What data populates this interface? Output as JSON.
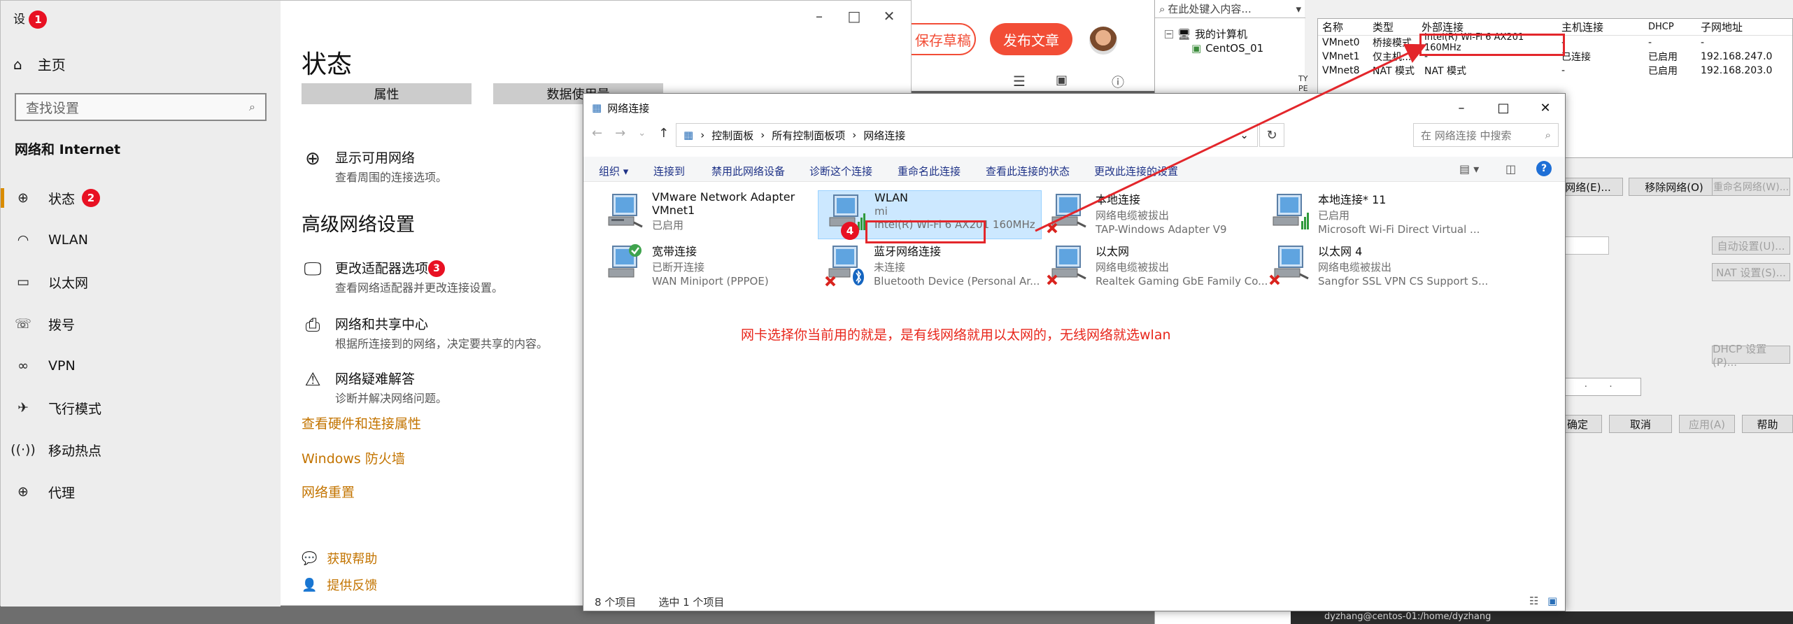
{
  "settings": {
    "title_char": "设",
    "badge1": "1",
    "badge2": "2",
    "badge3": "3",
    "home": "主页",
    "search_placeholder": "查找设置",
    "section": "网络和 Internet",
    "nav": [
      {
        "label": "状态",
        "icon": "globe-icon"
      },
      {
        "label": "WLAN",
        "icon": "wifi-icon"
      },
      {
        "label": "以太网",
        "icon": "ethernet-icon"
      },
      {
        "label": "拨号",
        "icon": "dialup-icon"
      },
      {
        "label": "VPN",
        "icon": "vpn-icon"
      },
      {
        "label": "飞行模式",
        "icon": "airplane-icon"
      },
      {
        "label": "移动热点",
        "icon": "hotspot-icon"
      },
      {
        "label": "代理",
        "icon": "proxy-icon"
      }
    ],
    "page_title": "状态",
    "tab_properties": "属性",
    "tab_data": "数据使用量",
    "show_networks": {
      "title": "显示可用网络",
      "sub": "查看周围的连接选项。"
    },
    "advanced_title": "高级网络设置",
    "adapter": {
      "title": "更改适配器选项",
      "sub": "查看网络适配器并更改连接设置。"
    },
    "sharing": {
      "title": "网络和共享中心",
      "sub": "根据所连接到的网络，决定要共享的内容。"
    },
    "troubleshoot": {
      "title": "网络疑难解答",
      "sub": "诊断并解决网络问题。"
    },
    "links": [
      "查看硬件和连接属性",
      "Windows 防火墙",
      "网络重置"
    ],
    "help": "获取帮助",
    "feedback": "提供反馈"
  },
  "blog": {
    "save": "保存草稿",
    "publish": "发布文章"
  },
  "vmtree": {
    "search": "在此处键入内容...",
    "root": "我的计算机",
    "child": "CentOS_01"
  },
  "vnet": {
    "headers": [
      "名称",
      "类型",
      "外部连接",
      "主机连接",
      "DHCP",
      "子网地址"
    ],
    "rows": [
      [
        "VMnet0",
        "桥接模式",
        "Intel(R) Wi-Fi 6 AX201 160MHz",
        "-",
        "-",
        "-"
      ],
      [
        "VMnet1",
        "仅主机...",
        "-",
        "已连接",
        "已启用",
        "192.168.247.0"
      ],
      [
        "VMnet8",
        "NAT 模式",
        "NAT 模式",
        "-",
        "已启用",
        "192.168.203.0"
      ]
    ],
    "buttons": {
      "add": "网络(E)...",
      "remove": "移除网络(O)",
      "rename": "重命名网络(W)...",
      "auto": "自动设置(U)...",
      "nat": "NAT 设置(S)...",
      "dhcp": "DHCP 设置(P)...",
      "ok": "确定",
      "cancel": "取消",
      "apply": "应用(A)",
      "help": "帮助"
    },
    "side_labels": [
      "TY",
      "PE"
    ]
  },
  "netwin": {
    "title": "网络连接",
    "breadcrumb": [
      "控制面板",
      "所有控制面板项",
      "网络连接"
    ],
    "search_placeholder": "在 网络连接 中搜索",
    "commands": [
      "组织 ▾",
      "连接到",
      "禁用此网络设备",
      "诊断这个连接",
      "重命名此连接",
      "查看此连接的状态",
      "更改此连接的设置"
    ],
    "adapters": [
      {
        "name": "VMware Network Adapter VMnet1",
        "l2": "",
        "l3": "已启用",
        "icon": "network-adapter-icon"
      },
      {
        "name": "WLAN",
        "l2": "mi",
        "l3": "Intel(R) Wi-Fi 6 AX201 160MHz",
        "icon": "wifi-adapter-icon"
      },
      {
        "name": "本地连接",
        "l2": "网络电缆被拔出",
        "l3": "TAP-Windows Adapter V9",
        "icon": "network-adapter-icon"
      },
      {
        "name": "本地连接* 11",
        "l2": "已启用",
        "l3": "Microsoft Wi-Fi Direct Virtual ...",
        "icon": "wifi-adapter-icon"
      },
      {
        "name": "宽带连接",
        "l2": "已断开连接",
        "l3": "WAN Miniport (PPPOE)",
        "icon": "broadband-icon"
      },
      {
        "name": "蓝牙网络连接",
        "l2": "未连接",
        "l3": "Bluetooth Device (Personal Ar...",
        "icon": "bluetooth-adapter-icon"
      },
      {
        "name": "以太网",
        "l2": "网络电缆被拔出",
        "l3": "Realtek Gaming GbE Family Co...",
        "icon": "network-adapter-icon"
      },
      {
        "name": "以太网 4",
        "l2": "网络电缆被拔出",
        "l3": "Sangfor SSL VPN CS Support S...",
        "icon": "network-adapter-icon"
      }
    ],
    "badge4": "4",
    "note": "网卡选择你当前用的就是，是有线网络就用以太网的，无线网络就选wlan",
    "status_count": "8 个项目",
    "status_selected": "选中 1 个项目"
  },
  "bottombar": "dyzhang@centos-01:/home/dyzhang",
  "colors": {
    "accent_orange": "#c37400",
    "red": "#e3262b",
    "publish": "#f24d36",
    "selected": "#cce8ff"
  }
}
